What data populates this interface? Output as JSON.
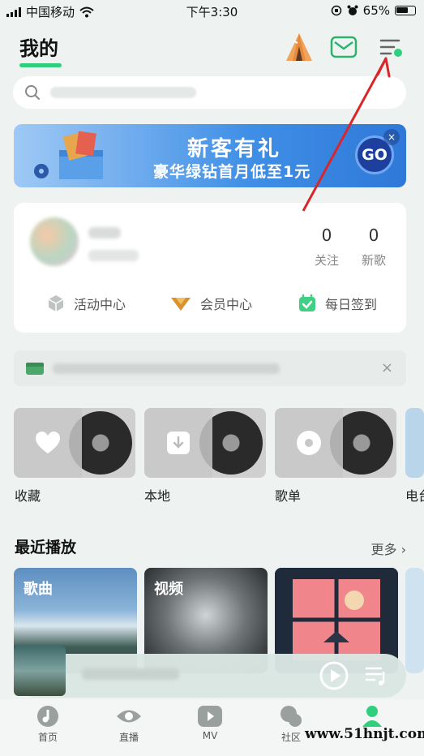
{
  "status_bar": {
    "carrier": "中国移动",
    "time": "下午3:30",
    "battery": "65%"
  },
  "header": {
    "title": "我的"
  },
  "search": {
    "placeholder": ""
  },
  "banner": {
    "headline": "新客有礼",
    "subline": "豪华绿钻首月低至1元",
    "go_label": "GO",
    "close": "×"
  },
  "profile": {
    "stats": [
      {
        "value": "0",
        "label": "关注"
      },
      {
        "value": "0",
        "label": "新歌"
      }
    ],
    "menu": [
      {
        "label": "活动中心"
      },
      {
        "label": "会员中心"
      },
      {
        "label": "每日签到"
      }
    ]
  },
  "notice": {
    "close": "×"
  },
  "quick_access": [
    {
      "label": "收藏"
    },
    {
      "label": "本地"
    },
    {
      "label": "歌单"
    },
    {
      "label": "电台"
    }
  ],
  "recent": {
    "title": "最近播放",
    "more": "更多",
    "cards": [
      {
        "label": "歌曲"
      },
      {
        "label": "视频"
      },
      {
        "label": ""
      }
    ]
  },
  "tabbar": [
    {
      "label": "首页"
    },
    {
      "label": "直播"
    },
    {
      "label": "MV"
    },
    {
      "label": "社区"
    }
  ],
  "watermark": "www.51hnjt.com"
}
